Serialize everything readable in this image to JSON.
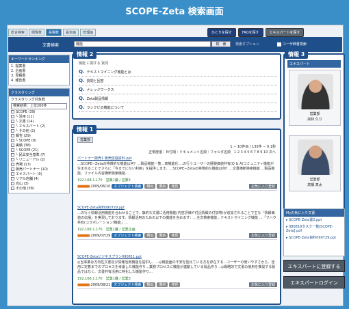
{
  "page_title": "SCOPE-Zeta 検索画面",
  "tabs": [
    "総合検索",
    "閲覧数",
    "投稿数",
    "設定画",
    "管理画"
  ],
  "top_buttons": [
    "ひとりを探す",
    "FAQを探す",
    "エキスパートを探す"
  ],
  "search": {
    "label": "文書検索",
    "value": "機能",
    "button": "検　索",
    "option": "検索オプション",
    "checkbox": "ユーザ辞書検索"
  },
  "keyword_ranking": {
    "title": "キーワードランキング",
    "items": [
      "1. 提案書",
      "2. 企画書",
      "3. 見積書",
      "4. 報告書"
    ]
  },
  "clustering": {
    "title": "クラスタリング",
    "target_label": "クラスタリング対象数",
    "select": "検索結果：上位200件",
    "items": [
      "SCOPE (39)",
      "└ 活用 (11)",
      "└ 文書 (14)",
      "└ エキスパート (2)",
      "└ その他 (2)",
      "報告 (29)",
      "└ SCOPE (9)",
      "実績 (38)",
      "└ SCOPE (21)",
      "└ 民具安全基準 (7)",
      "└ リニューアル (2)",
      "売場 (17)",
      "販売パートナー (10)",
      "エキスパート (9)",
      "リアル店舗 (4)",
      "烏山 (3)",
      "その他 (38)"
    ]
  },
  "info2": {
    "label": "情報 2",
    "sub": "機能 に関する 質問",
    "questions": [
      "テキストマイニング機能とは",
      "質問と回答",
      "ナレッジワークス",
      "Zeta製品情報",
      "ランクビの機能について"
    ]
  },
  "info1": {
    "label": "情報 1",
    "tab": "営業部",
    "pager": "1 − 10件目 / 135件 − 0.1秒",
    "sort": "正規度順｜日付順｜ドキュメント名順｜フォルダ名順　1 2 3 4 5 6 7 8 9 10 次へ",
    "results": [
      {
        "title": "パートナー販売1 販売促進資料.ppt",
        "snippet": "…SCOPE−Zetaの特徴的な機能は何？…製品機能一覧…高機能化 …の行うユーザーの経験価値共有(Q & A)コミュニティ機能が生まれることでさらに「今までにない利用」を提供します。…SCOPE−Zetaの特徴的な機能は何？…文書横断検索機能 …製品機能、ファイル内容横断検索機能…",
        "meta": "192.168.1.170　営業1課 / 営業3",
        "date": "2009/06/10",
        "tags": [
          "オブジェクト検索",
          "類似",
          "要約",
          "発見"
        ],
        "add": "お気に入り登録"
      },
      {
        "title": "SCOPE-Zeta資料090729.ppt",
        "snippet": "…の行う情報活用機能を合わせることで、静的な文書に活用機能(内容評価や付記情報の付加等)が追加されることで主な「情報価値の伝播」を実現しております。情報活用のための以下の機能を含めます：…全文検索機能…テキストマイニング機能 …「フハウ共有(コラボレーション)機能」…",
        "meta": "192.168.1.170　営業1課 / 営業企画",
        "date": "2009/07/29",
        "tags": [
          "オブジェクト検索",
          "類似",
          "要約",
          "発見"
        ],
        "add": "お気に入り登録"
      },
      {
        "title": "SCOPE-Zetaビジネスプラン090811.ppt",
        "snippet": "◎当事業は方向性文書及び情報活用機能を提供し、…◎機能面の不安を抱えている方を存在する…ユーザーの使いやすさから、活用に定着までのプロセスを考慮した機能作り…業務プロセスに機能が連動している製品作り…◎戦略的で文書の使用を推奨する製品ではなく、文書共有活用に特化した機能作り…",
        "meta": "192.168.1.170　営業1課 / 営業3",
        "date": "2009/08/21",
        "tags": [
          "オブジェクト検索",
          "類似",
          "要約",
          "発見"
        ],
        "add": "お気に入り登録"
      }
    ]
  },
  "info3": {
    "label": "情報 3",
    "head": "エキスパート",
    "experts": [
      {
        "dept": "営業部",
        "name": "高林 久り"
      },
      {
        "dept": "営業部",
        "name": "高橋 真太"
      }
    ]
  },
  "favorites": {
    "title": "Myお気に入り文書",
    "items": [
      "SCOPE-Zeta置2.ppt",
      "080818タスク一覧[SCOPE-Zeta].pdf",
      "SCOPE-Zeta資料090729.ppt"
    ]
  },
  "buttons": {
    "register": "エキスパートに登録する",
    "login": "エキスパートログイン"
  },
  "colors": {
    "accent": "#1f4f8a",
    "background": "#3a8fc8"
  }
}
